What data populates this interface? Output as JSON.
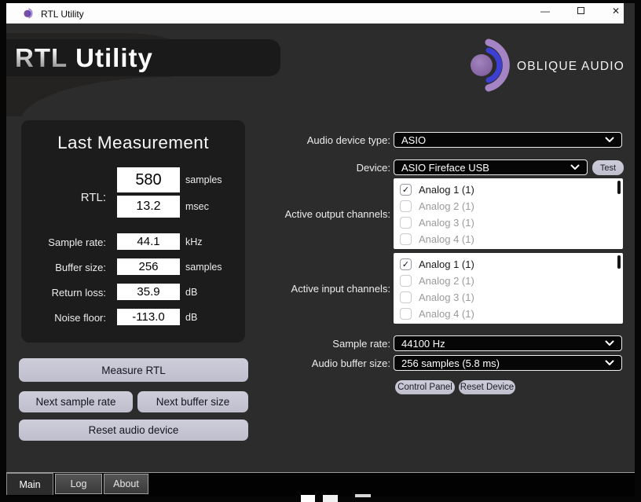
{
  "titlebar": {
    "title": "RTL Utility",
    "minimize_glyph": "—",
    "close_glyph": "✕"
  },
  "header": {
    "title_part1": "RTL",
    "title_part2": "Utility",
    "brand": "OBLIQUE AUDIO"
  },
  "last_measurement": {
    "title": "Last Measurement",
    "rtl_label": "RTL:",
    "rtl_samples_value": "580",
    "rtl_samples_unit": "samples",
    "rtl_msec_value": "13.2",
    "rtl_msec_unit": "msec",
    "rows": [
      {
        "label": "Sample rate:",
        "value": "44.1",
        "unit": "kHz"
      },
      {
        "label": "Buffer size:",
        "value": "256",
        "unit": "samples"
      },
      {
        "label": "Return loss:",
        "value": "35.9",
        "unit": "dB"
      },
      {
        "label": "Noise floor:",
        "value": "-113.0",
        "unit": "dB"
      }
    ]
  },
  "actions": {
    "measure": "Measure RTL",
    "next_sample_rate": "Next sample rate",
    "next_buffer_size": "Next buffer size",
    "reset_audio_device": "Reset audio device"
  },
  "device_form": {
    "audio_device_type_label": "Audio device type:",
    "audio_device_type_value": "ASIO",
    "device_label": "Device:",
    "device_value": "ASIO Fireface USB",
    "test_button": "Test",
    "output_channels_label": "Active output channels:",
    "input_channels_label": "Active input channels:",
    "output_channels": [
      {
        "label": "Analog 1 (1)",
        "checked": true,
        "check": "✓"
      },
      {
        "label": "Analog 2 (1)",
        "checked": false,
        "check": ""
      },
      {
        "label": "Analog 3 (1)",
        "checked": false,
        "check": ""
      },
      {
        "label": "Analog 4 (1)",
        "checked": false,
        "check": ""
      }
    ],
    "input_channels": [
      {
        "label": "Analog 1 (1)",
        "checked": true,
        "check": "✓"
      },
      {
        "label": "Analog 2 (1)",
        "checked": false,
        "check": ""
      },
      {
        "label": "Analog 3 (1)",
        "checked": false,
        "check": ""
      },
      {
        "label": "Analog 4 (1)",
        "checked": false,
        "check": ""
      }
    ],
    "sample_rate_label": "Sample rate:",
    "sample_rate_value": "44100 Hz",
    "buffer_size_label": "Audio buffer size:",
    "buffer_size_value": "256 samples (5.8 ms)",
    "control_panel_button": "Control Panel",
    "reset_device_button": "Reset Device"
  },
  "tabs": [
    {
      "label": "Main",
      "active": true
    },
    {
      "label": "Log",
      "active": false
    },
    {
      "label": "About",
      "active": false
    }
  ],
  "colors": {
    "body_bg": "#2d2c2c",
    "panel_bg": "#1d1c1c",
    "header_panel_bg": "#1b1a1a",
    "button_bg": "#c6c6d4",
    "select_bg": "#060606",
    "brand_purple": "#9a79bd",
    "brand_blue": "#3c3fd2",
    "titlebar_bg": "#fdfdfd"
  }
}
